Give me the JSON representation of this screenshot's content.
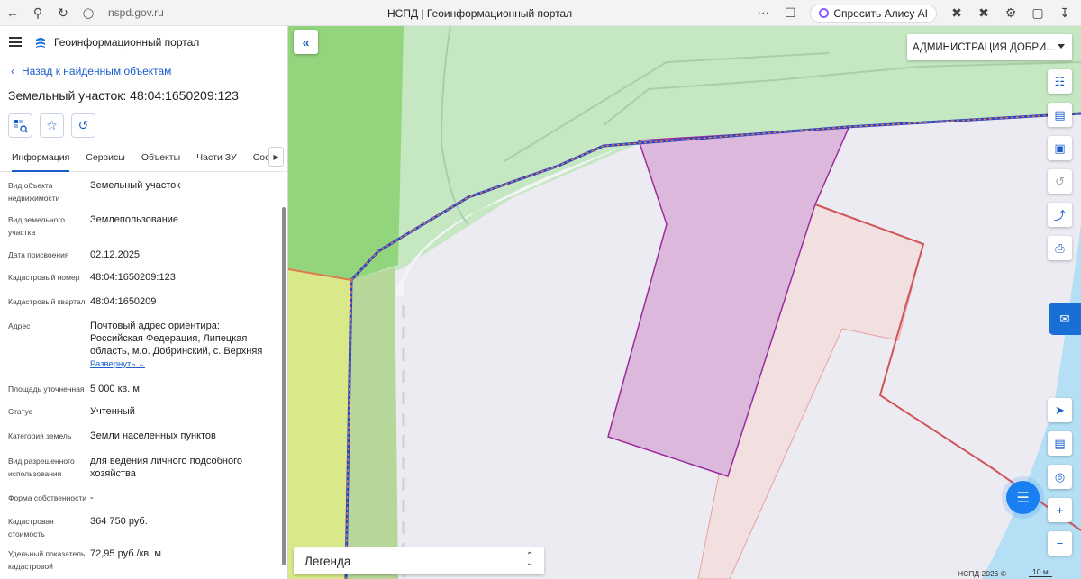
{
  "browser": {
    "url": "nspd.gov.ru",
    "tab_title": "НСПД | Геоинформационный портал",
    "alisa_label": "Спросить Алису AI"
  },
  "panel": {
    "app_title": "Геоинформационный портал",
    "back_label": "Назад к найденным объектам",
    "parcel_title": "Земельный участок: 48:04:1650209:123",
    "tabs": [
      "Информация",
      "Сервисы",
      "Объекты",
      "Части ЗУ",
      "Состав"
    ],
    "active_tab": "Информация",
    "fields": [
      {
        "label": "Вид объекта недвижимости",
        "value": "Земельный участок"
      },
      {
        "label": "Вид земельного участка",
        "value": "Землепользование"
      },
      {
        "label": "Дата присвоения",
        "value": "02.12.2025"
      },
      {
        "label": "Кадастровый номер",
        "value": "48:04:1650209:123"
      },
      {
        "label": "Кадастровый квартал",
        "value": "48:04:1650209"
      },
      {
        "label": "Адрес",
        "value": "Почтовый адрес ориентира: Российская Федерация, Липецкая область, м.о. Добринский, с. Верхняя",
        "expand": "Развернуть"
      },
      {
        "label": "Площадь уточненная",
        "value": "5 000 кв. м"
      },
      {
        "label": "Статус",
        "value": "Учтенный"
      },
      {
        "label": "Категория земель",
        "value": "Земли населенных пунктов"
      },
      {
        "label": "Вид разрешенного использования",
        "value": "для ведения личного подсобного хозяйства"
      },
      {
        "label": "Форма собственности",
        "value": "-"
      },
      {
        "label": "Кадастровая стоимость",
        "value": "364 750 руб."
      },
      {
        "label": "Удельный показатель кадастровой",
        "value": "72,95 руб./кв. м"
      }
    ]
  },
  "map": {
    "admin_select": "АДМИНИСТРАЦИЯ ДОБРИ...",
    "legend_label": "Легенда",
    "copyright": "НСПД 2026 ©",
    "scale": "10 м",
    "colors": {
      "selected_parcel": "#dcb9dc",
      "selected_parcel_border": "#9b2c9b",
      "neighbor_parcel": "#f2dfe0",
      "neighbor_border": "#d0555a",
      "green_zone": "#c5e8c3",
      "dark_green": "#93d57c",
      "yellow_zone": "#d9e98a",
      "water": "#b4dff5",
      "background": "#ecebf2",
      "accent": "#1a6fd6"
    }
  }
}
